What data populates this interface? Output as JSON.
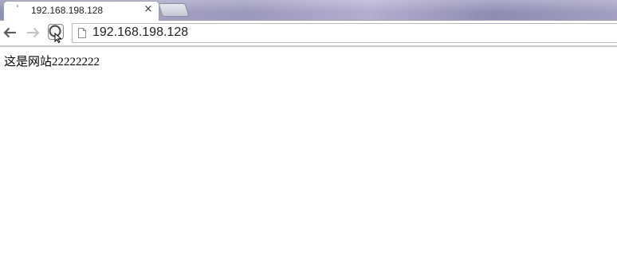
{
  "tab": {
    "title": "192.168.198.128",
    "favicon": "loading-spinner-icon",
    "close_icon": "×"
  },
  "toolbar": {
    "back_icon": "back-arrow-icon",
    "forward_icon": "forward-arrow-icon",
    "reload_icon": "reload-icon",
    "address": "192.168.198.128"
  },
  "page": {
    "body_text": "这是网站22222222"
  },
  "colors": {
    "tabstrip": "#9b98bd",
    "tab_background": "#ffffff",
    "text": "#000000"
  }
}
